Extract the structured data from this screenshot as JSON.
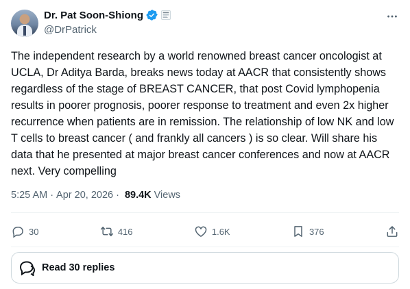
{
  "author": {
    "name": "Dr. Pat Soon-Shiong",
    "handle": "@DrPatrick"
  },
  "tweet": {
    "text": "The independent research by a world renowned breast cancer oncologist at UCLA, Dr Aditya Barda, breaks news today at AACR that consistently shows regardless of the stage of BREAST CANCER, that post Covid lymphopenia results in poorer prognosis, poorer response to treatment and even 2x higher recurrence when patients are in remission. The relationship of low NK and low T cells to breast cancer ( and frankly all cancers ) is so clear. Will share his data that he presented at major breast cancer conferences and now at AACR next. Very compelling",
    "time": "5:25 AM",
    "separator": "·",
    "date": "Apr 20, 2026",
    "views_count": "89.4K",
    "views_label": "Views"
  },
  "actions": {
    "replies": "30",
    "reposts": "416",
    "likes": "1.6K",
    "bookmarks": "376"
  },
  "replies_button": {
    "label": "Read 30 replies"
  },
  "colors": {
    "verified": "#1d9bf0",
    "text": "#0f1419",
    "muted": "#536471",
    "border": "#cfd9de"
  },
  "icons": [
    "verified-badge-icon",
    "affiliate-badge-icon",
    "more-icon",
    "reply-icon",
    "repost-icon",
    "like-icon",
    "bookmark-icon",
    "share-icon",
    "speech-bubble-icon"
  ]
}
